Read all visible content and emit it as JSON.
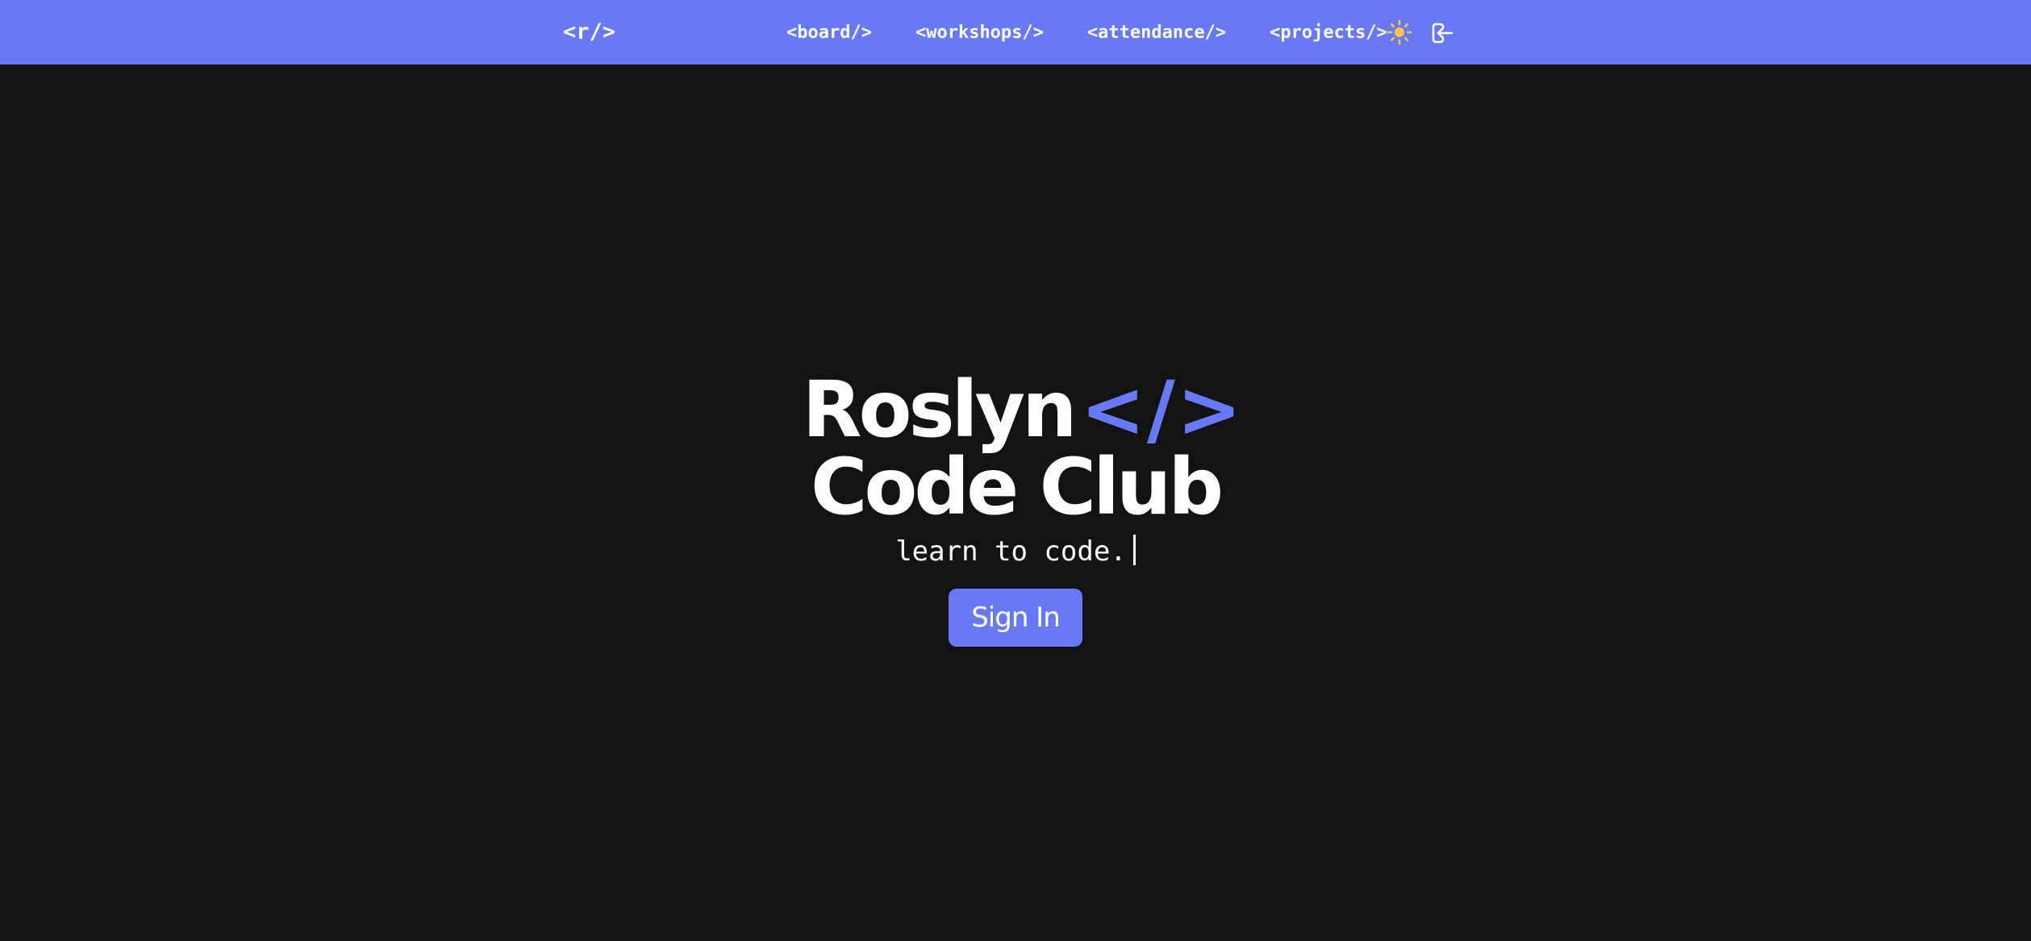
{
  "nav": {
    "logo": "<r/>",
    "links": [
      "<board/>",
      "<workshops/>",
      "<attendance/>",
      "<projects/>"
    ],
    "theme_icon": "sun-icon",
    "signout_icon": "sign-in-arrow-icon"
  },
  "hero": {
    "title_line1": "Roslyn",
    "title_accent": "</>",
    "title_line2": "Code Club",
    "tagline": "learn to code."
  },
  "signin": {
    "label": "Sign In"
  },
  "colors": {
    "accent": "#6779f5",
    "background": "#131313",
    "text": "#ffffff",
    "sun": "#f7c948"
  }
}
